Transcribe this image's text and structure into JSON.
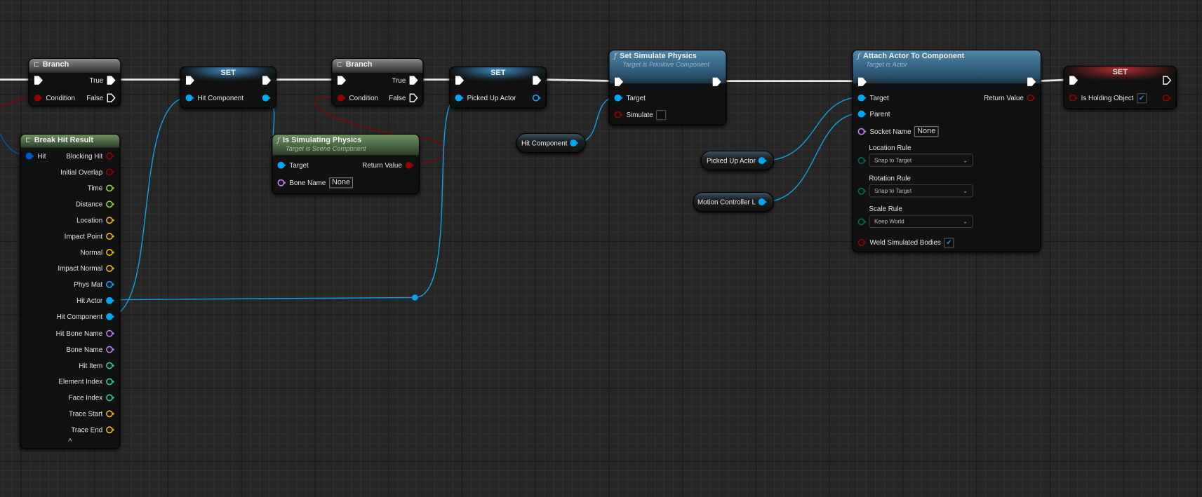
{
  "pin_colors": {
    "exec": "#ffffff",
    "bool": "#950000",
    "object": "#00a8f4",
    "struct": "#0057c8",
    "float": "#8bd63a",
    "vector": "#f0b800",
    "name": "#c080ef",
    "int": "#1fcf9e",
    "enum": "#006a5c"
  },
  "nodes": {
    "branch_1": {
      "title": "Branch",
      "icon": "branch-icon",
      "in": [
        {
          "label": "",
          "type": "exec"
        },
        {
          "label": "Condition",
          "type": "bool",
          "filled": true
        }
      ],
      "out": [
        {
          "label": "True",
          "type": "exec",
          "filled": true
        },
        {
          "label": "False",
          "type": "exec",
          "filled": false
        }
      ]
    },
    "set_1": {
      "title": "SET",
      "in": [
        {
          "label": "",
          "type": "exec"
        },
        {
          "label": "Hit Component",
          "type": "object",
          "filled": true
        }
      ],
      "out": [
        {
          "label": "",
          "type": "exec",
          "filled": true
        },
        {
          "label": "",
          "type": "object",
          "filled": true
        }
      ]
    },
    "branch_2": {
      "title": "Branch",
      "icon": "branch-icon",
      "in": [
        {
          "label": "",
          "type": "exec"
        },
        {
          "label": "Condition",
          "type": "bool",
          "filled": true
        }
      ],
      "out": [
        {
          "label": "True",
          "type": "exec",
          "filled": true
        },
        {
          "label": "False",
          "type": "exec",
          "filled": false
        }
      ]
    },
    "set_2": {
      "title": "SET",
      "in": [
        {
          "label": "",
          "type": "exec"
        },
        {
          "label": "Picked Up Actor",
          "type": "object",
          "filled": true
        }
      ],
      "out": [
        {
          "label": "",
          "type": "exec",
          "filled": true
        },
        {
          "label": "",
          "type": "object",
          "filled": false
        }
      ]
    },
    "set_simulate_physics": {
      "title": "Set Simulate Physics",
      "subtitle": "Target is Primitive Component",
      "icon": "function-icon",
      "in": [
        {
          "label": "",
          "type": "exec"
        },
        {
          "label": "Target",
          "type": "object",
          "filled": true
        },
        {
          "label": "Simulate",
          "type": "bool",
          "filled": false,
          "checkbox": false
        }
      ],
      "out": [
        {
          "label": "",
          "type": "exec",
          "filled": true
        }
      ]
    },
    "attach_actor_to_component": {
      "title": "Attach Actor To Component",
      "subtitle": "Target is Actor",
      "icon": "function-icon",
      "in": [
        {
          "label": "",
          "type": "exec"
        },
        {
          "label": "Target",
          "type": "object",
          "filled": true
        },
        {
          "label": "Parent",
          "type": "object",
          "filled": true
        },
        {
          "label": "Socket Name",
          "type": "name",
          "filled": false,
          "text_value": "None"
        },
        {
          "label": "Location Rule",
          "type": "enum",
          "filled": false,
          "dropdown": "Snap to Target"
        },
        {
          "label": "Rotation Rule",
          "type": "enum",
          "filled": false,
          "dropdown": "Snap to Target"
        },
        {
          "label": "Scale Rule",
          "type": "enum",
          "filled": false,
          "dropdown": "Keep World"
        },
        {
          "label": "Weld Simulated Bodies",
          "type": "bool",
          "filled": false,
          "checkbox": true
        }
      ],
      "out": [
        {
          "label": "",
          "type": "exec",
          "filled": true
        },
        {
          "label": "Return Value",
          "type": "bool",
          "filled": false
        }
      ]
    },
    "set_3": {
      "title": "SET",
      "in": [
        {
          "label": "",
          "type": "exec"
        },
        {
          "label": "Is Holding Object",
          "type": "bool",
          "filled": false,
          "checkbox": true
        }
      ],
      "out": [
        {
          "label": "",
          "type": "exec",
          "filled": false
        },
        {
          "label": "",
          "type": "bool",
          "filled": false
        }
      ]
    },
    "break_hit_result": {
      "title": "Break Hit Result",
      "icon": "break-struct-icon",
      "in": [
        {
          "label": "Hit",
          "type": "struct",
          "filled": true
        }
      ],
      "out": [
        {
          "label": "Blocking Hit",
          "type": "bool"
        },
        {
          "label": "Initial Overlap",
          "type": "bool"
        },
        {
          "label": "Time",
          "type": "float"
        },
        {
          "label": "Distance",
          "type": "float"
        },
        {
          "label": "Location",
          "type": "vector"
        },
        {
          "label": "Impact Point",
          "type": "vector"
        },
        {
          "label": "Normal",
          "type": "vector"
        },
        {
          "label": "Impact Normal",
          "type": "vector"
        },
        {
          "label": "Phys Mat",
          "type": "object"
        },
        {
          "label": "Hit Actor",
          "type": "object",
          "filled": true
        },
        {
          "label": "Hit Component",
          "type": "object",
          "filled": true
        },
        {
          "label": "Hit Bone Name",
          "type": "name"
        },
        {
          "label": "Bone Name",
          "type": "name"
        },
        {
          "label": "Hit Item",
          "type": "int"
        },
        {
          "label": "Element Index",
          "type": "int"
        },
        {
          "label": "Face Index",
          "type": "int"
        },
        {
          "label": "Trace Start",
          "type": "vector"
        },
        {
          "label": "Trace End",
          "type": "vector"
        }
      ],
      "footer": "^"
    },
    "is_simulating_physics": {
      "title": "Is Simulating Physics",
      "subtitle": "Target is Scene Component",
      "icon": "function-icon",
      "in": [
        {
          "label": "Target",
          "type": "object",
          "filled": true
        },
        {
          "label": "Bone Name",
          "type": "name",
          "filled": false,
          "text_value": "None"
        }
      ],
      "out": [
        {
          "label": "Return Value",
          "type": "bool",
          "filled": true
        }
      ]
    }
  },
  "getters": {
    "hit_component": {
      "label": "Hit Component",
      "type": "object"
    },
    "picked_up_actor": {
      "label": "Picked Up Actor",
      "type": "object"
    },
    "motion_controller_l": {
      "label": "Motion Controller L",
      "type": "object"
    }
  }
}
